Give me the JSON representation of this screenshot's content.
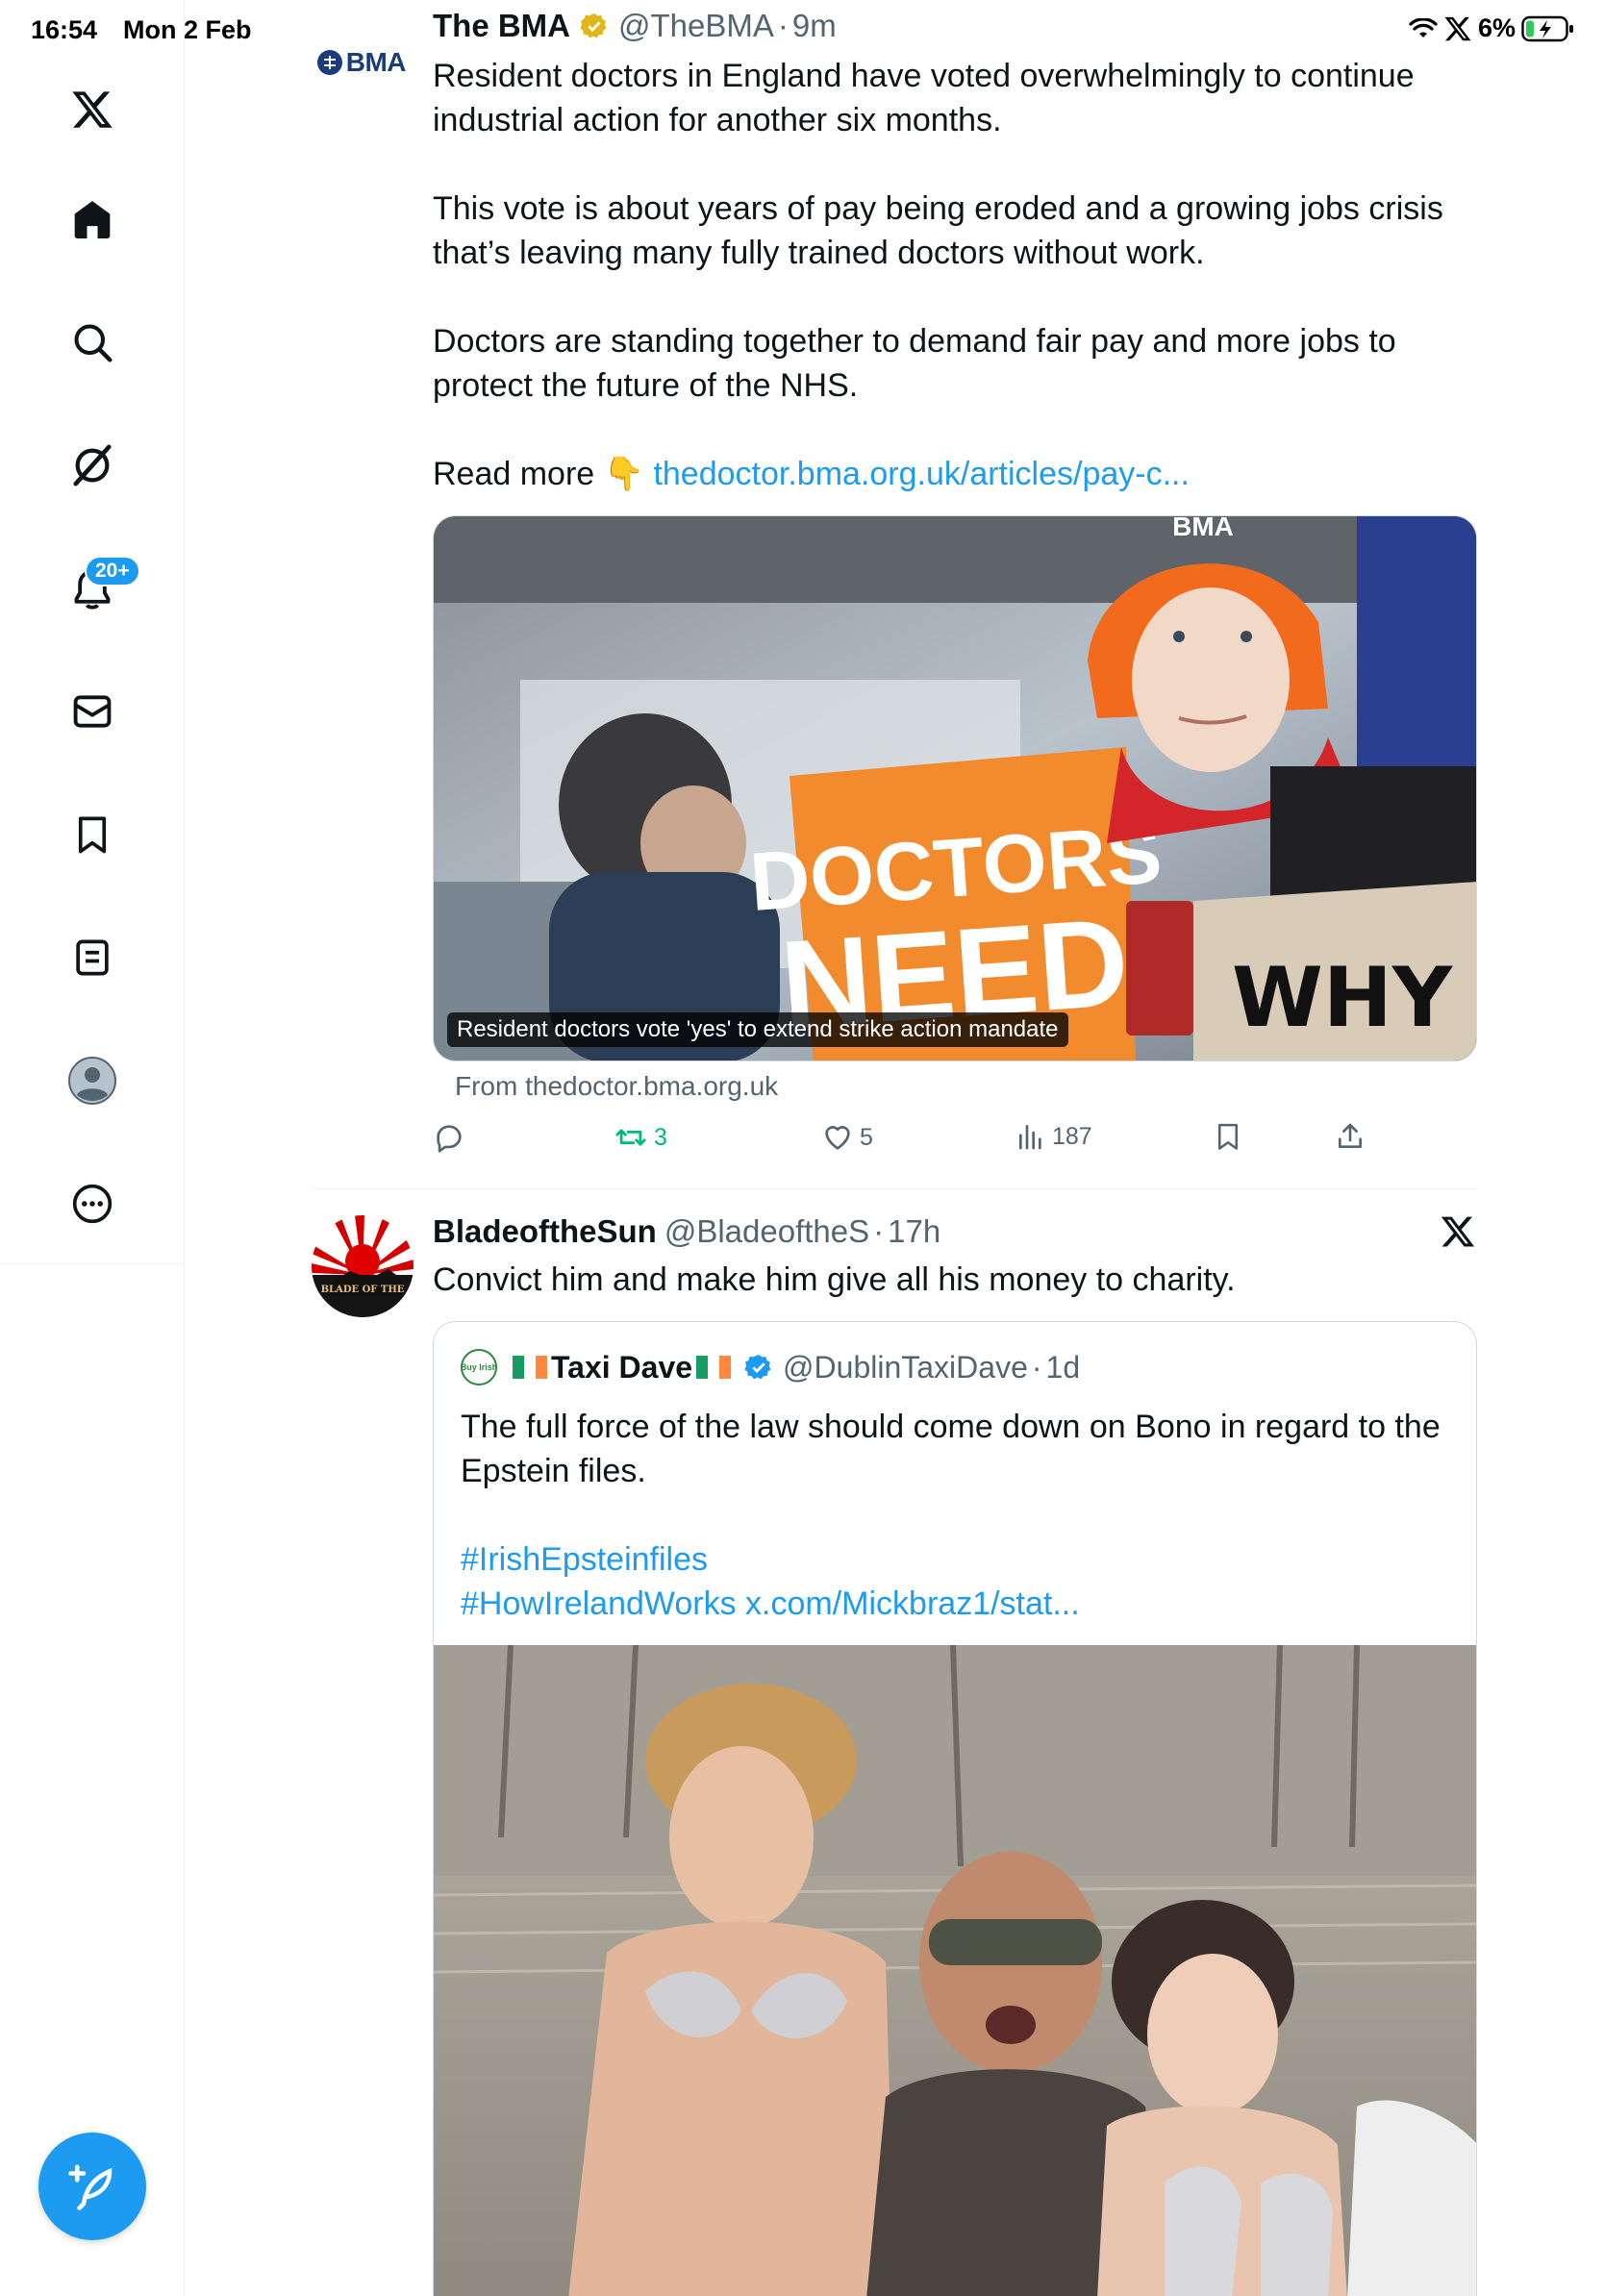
{
  "status_bar": {
    "time": "16:54",
    "date": "Mon 2 Feb",
    "battery": "6%"
  },
  "sidebar": {
    "items": [
      {
        "name": "x-logo"
      },
      {
        "name": "home"
      },
      {
        "name": "search"
      },
      {
        "name": "grok"
      },
      {
        "name": "notifications",
        "badge": "20+"
      },
      {
        "name": "messages"
      },
      {
        "name": "bookmarks"
      },
      {
        "name": "lists"
      },
      {
        "name": "profile"
      },
      {
        "name": "more"
      }
    ],
    "accent": "#1d9bf0"
  },
  "tweet1": {
    "avatar_text": "BMA",
    "name": "The BMA",
    "handle": "@TheBMA",
    "time": "9m",
    "paragraphs": [
      "Resident doctors in England have voted overwhelmingly to continue industrial action for another six months.",
      "This vote is about years of pay being eroded and a growing jobs crisis that’s leaving many fully trained doctors without work.",
      "Doctors are standing together to demand fair pay and more jobs to protect the future of the NHS."
    ],
    "read_more": "Read more",
    "read_more_emoji": "👇",
    "link": "thedoctor.bma.org.uk/articles/pay-c...",
    "card": {
      "caption": "Resident doctors vote 'yes' to extend strike action mandate",
      "from": "From thedoctor.bma.org.uk",
      "sign_line1": "DOCTORS",
      "sign_line2": "NEED",
      "hat_text": "BMA",
      "placard": "WHY IS M"
    },
    "stats": {
      "replies": "",
      "reposts": "3",
      "likes": "5",
      "views": "187"
    }
  },
  "tweet2": {
    "name": "BladeoftheSun",
    "handle": "@BladeoftheS",
    "time": "17h",
    "avatar_text": "BLADE OF THE",
    "text": "Convict him and make him give all his money to charity.",
    "quote": {
      "avatar_text": "Buy Irish",
      "name": "Taxi Dave",
      "handle": "@DublinTaxiDave",
      "time": "1d",
      "text": "The full force of the law should come down on Bono in regard to the Epstein files.",
      "hashtag1": "#IrishEpsteinfiles",
      "hashtag2": "#HowIrelandWorks",
      "link": "x.com/Mickbraz1/stat..."
    }
  }
}
